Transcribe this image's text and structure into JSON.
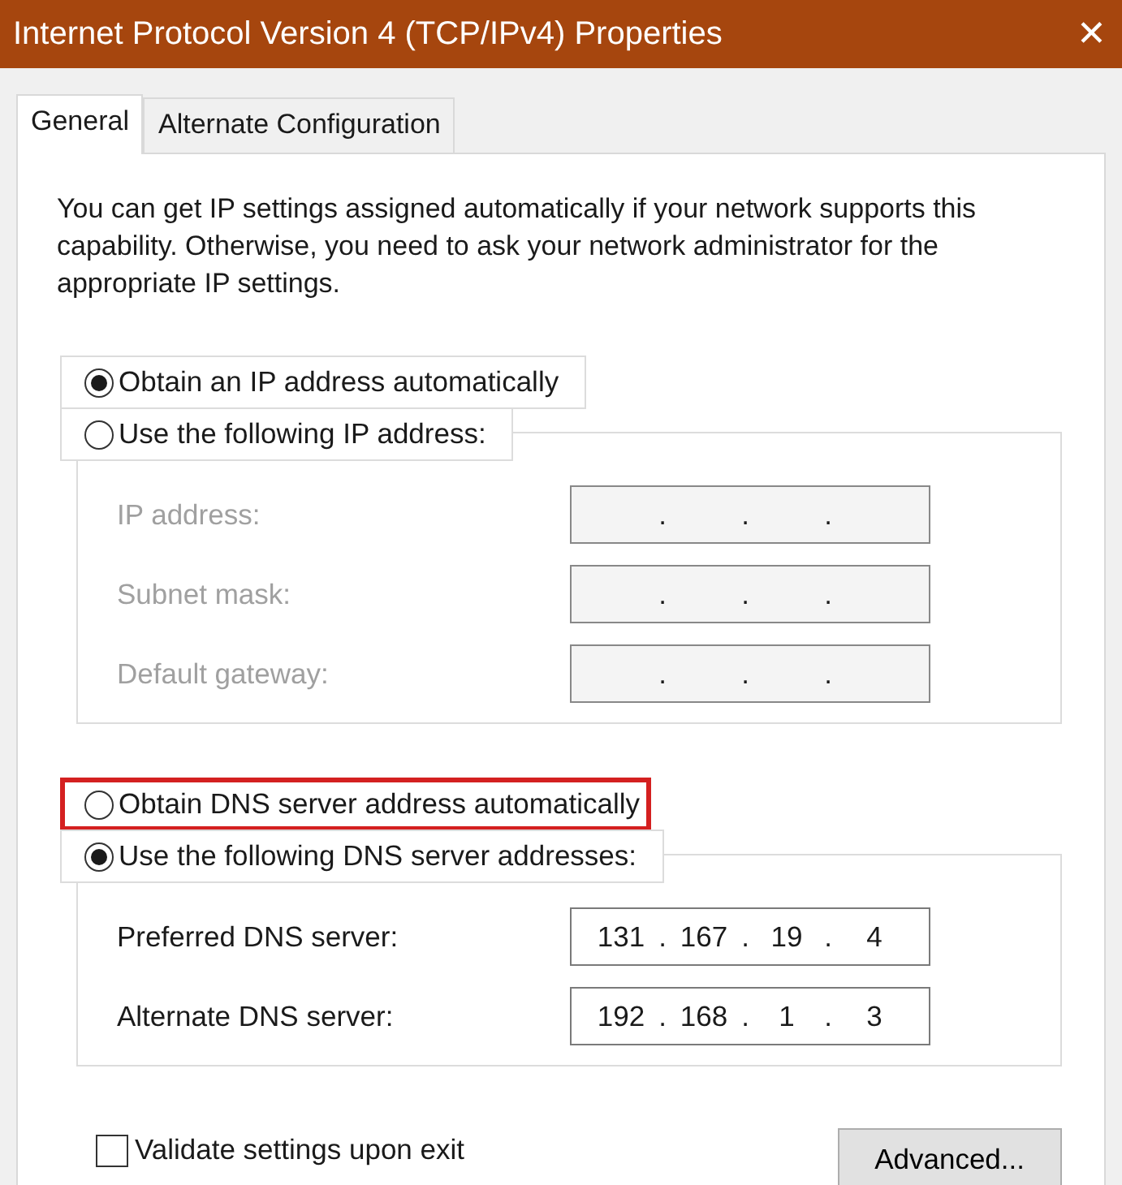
{
  "window": {
    "title": "Internet Protocol Version 4 (TCP/IPv4) Properties",
    "close": "✕"
  },
  "tabs": [
    {
      "label": "General",
      "selected": true
    },
    {
      "label": "Alternate Configuration",
      "selected": false
    }
  ],
  "description": "You can get IP settings assigned automatically if your network supports this capability. Otherwise, you need to ask your network administrator for the appropriate IP settings.",
  "ip_section": {
    "options": [
      {
        "label": "Obtain an IP address automatically",
        "selected": true,
        "highlighted": false
      },
      {
        "label": "Use the following IP address:",
        "selected": false,
        "highlighted": false
      }
    ],
    "fields": [
      {
        "label": "IP address:",
        "disabled": true,
        "separator": "."
      },
      {
        "label": "Subnet mask:",
        "disabled": true,
        "separator": "."
      },
      {
        "label": "Default gateway:",
        "disabled": true,
        "separator": "."
      }
    ]
  },
  "dns_section": {
    "options": [
      {
        "label": "Obtain DNS server address automatically",
        "selected": false,
        "highlighted": true
      },
      {
        "label": "Use the following DNS server addresses:",
        "selected": true,
        "highlighted": false
      }
    ],
    "fields": [
      {
        "label": "Preferred DNS server:",
        "disabled": false,
        "separator": ".",
        "octets": [
          "131",
          "167",
          "19",
          "4"
        ]
      },
      {
        "label": "Alternate DNS server:",
        "disabled": false,
        "separator": ".",
        "octets": [
          "192",
          "168",
          "1",
          "3"
        ]
      }
    ]
  },
  "validate": {
    "label": "Validate settings upon exit",
    "checked": false
  },
  "advanced_button": "Advanced..."
}
